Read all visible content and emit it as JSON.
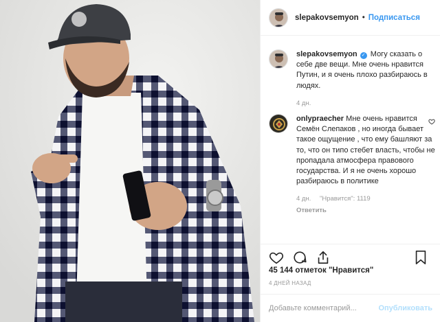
{
  "post": {
    "author": "slepakovsemyon",
    "follow_label": "Подписаться",
    "separator": "•"
  },
  "caption": {
    "username": "slepakovsemyon",
    "text": "Могу сказать о себе две вещи. Мне очень нравится Путин, и я очень плохо разбираюсь в людях.",
    "time": "4 дн."
  },
  "comment": {
    "username": "onlypraecher",
    "text": "Мне очень нравится Семён Слепаков , но иногда бывает такое ощущение , что ему башляют за то, что он типо стебет власть, чтобы не пропадала атмосфера правового государства. И я не очень хорошо разбираюсь в политике",
    "time": "4 дн.",
    "likes": "\"Нравится\": 1119",
    "reply_label": "Ответить"
  },
  "footer": {
    "likes": "45 144 отметок \"Нравится\"",
    "time_ago": "4 ДНЕЙ НАЗАД",
    "comment_placeholder": "Добавьте комментарий...",
    "publish_label": "Опубликовать"
  },
  "icons": {
    "like": "heart-icon",
    "comment": "comment-icon",
    "share": "share-icon",
    "save": "bookmark-icon",
    "verified": "verified-badge-icon"
  },
  "colors": {
    "link_blue": "#3897f0",
    "publish_disabled": "#b2dffc",
    "muted": "#999999",
    "text": "#262626"
  }
}
